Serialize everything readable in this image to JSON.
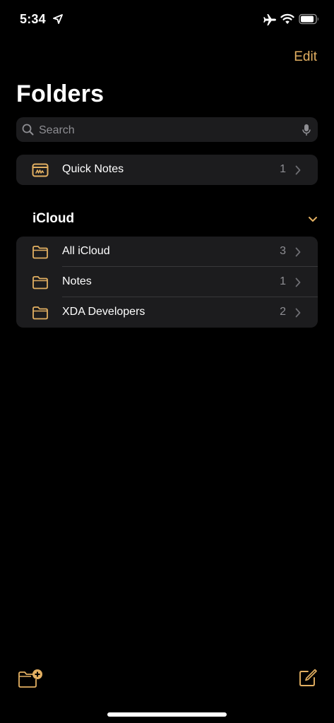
{
  "status": {
    "time": "5:34"
  },
  "nav": {
    "edit_label": "Edit",
    "title": "Folders"
  },
  "search": {
    "placeholder": "Search"
  },
  "quick_notes": {
    "label": "Quick Notes",
    "count": "1"
  },
  "icloud": {
    "header": "iCloud",
    "folders": [
      {
        "label": "All iCloud",
        "count": "3"
      },
      {
        "label": "Notes",
        "count": "1"
      },
      {
        "label": "XDA Developers",
        "count": "2"
      }
    ]
  },
  "toolbar": {
    "new_folder_icon": "folder-plus-icon",
    "compose_icon": "compose-icon"
  },
  "colors": {
    "accent": "#e3b062",
    "background": "#000000",
    "cell": "#1c1c1e",
    "secondary_text": "#8e8e93"
  }
}
